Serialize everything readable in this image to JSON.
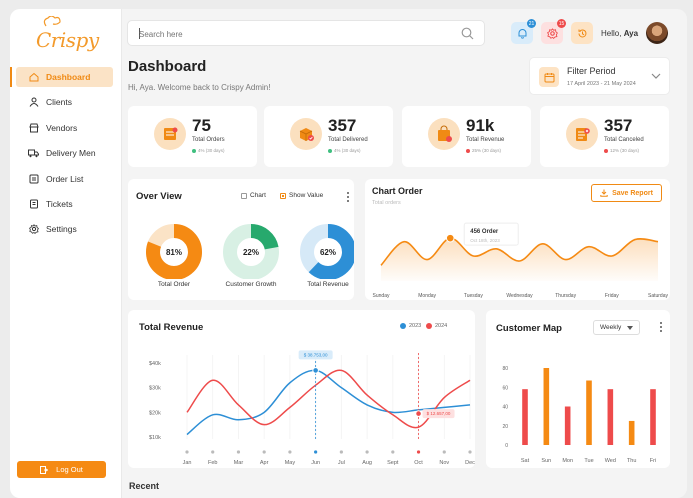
{
  "brand": {
    "logo_text": "Crispy",
    "accent": "#f58a13"
  },
  "sidebar": {
    "items": [
      {
        "label": "Dashboard",
        "icon": "home-icon",
        "active": true
      },
      {
        "label": "Clients",
        "icon": "user-icon",
        "active": false
      },
      {
        "label": "Vendors",
        "icon": "store-icon",
        "active": false
      },
      {
        "label": "Delivery Men",
        "icon": "truck-icon",
        "active": false
      },
      {
        "label": "Order List",
        "icon": "list-icon",
        "active": false
      },
      {
        "label": "Tickets",
        "icon": "ticket-icon",
        "active": false
      },
      {
        "label": "Settings",
        "icon": "gear-icon",
        "active": false
      }
    ],
    "logout_label": "Log Out"
  },
  "header": {
    "search_placeholder": "Search here",
    "notifications_count": "21",
    "settings_count": "15",
    "hello_prefix": "Hello,",
    "user_name": "Aya",
    "title": "Dashboard",
    "subtitle": "Hi, Aya. Welcome back  to Crispy Admin!"
  },
  "filter": {
    "title": "Filter Period",
    "range": "17 April 2023 - 21 May 2024"
  },
  "stats": [
    {
      "value": "75",
      "label": "Total Orders",
      "sub": "4% (30 days)",
      "trend": "up"
    },
    {
      "value": "357",
      "label": "Total Delivered",
      "sub": "4% (30 days)",
      "trend": "up"
    },
    {
      "value": "91k",
      "label": "Total Revenue",
      "sub": "25% (30 days)",
      "trend": "down"
    },
    {
      "value": "357",
      "label": "Total Canceled",
      "sub": "12% (30 days)",
      "trend": "down"
    }
  ],
  "overview": {
    "title": "Over View",
    "chart_label": "Chart",
    "show_value_label": "Show Value",
    "donuts": [
      {
        "label": "Total Order",
        "value": "81%",
        "fraction": 0.81,
        "color": "#f58a13",
        "track": "#fbe3c6"
      },
      {
        "label": "Customer Growth",
        "value": "22%",
        "fraction": 0.22,
        "color": "#27a96d",
        "track": "#d8f0e4"
      },
      {
        "label": "Total Revenue",
        "value": "62%",
        "fraction": 0.62,
        "color": "#2d8fd6",
        "track": "#d6e9f7"
      }
    ]
  },
  "chart_order": {
    "title": "Chart Order",
    "subtitle": "Total orders",
    "save_label": "Save Report",
    "tooltip_value": "456",
    "tooltip_label": "Order",
    "tooltip_date": "Oct 18th, 2023"
  },
  "total_revenue": {
    "title": "Total Revenue",
    "legend": [
      {
        "name": "2023",
        "color": "#2d8fd6"
      },
      {
        "name": "2024",
        "color": "#ee4b4b"
      }
    ],
    "tip1": "$ 38.753,00",
    "tip2": "$ 12.657,00"
  },
  "customer_map": {
    "title": "Customer Map",
    "period": "Weekly"
  },
  "recent_label": "Recent",
  "chart_data": [
    {
      "type": "area",
      "title": "Chart Order",
      "subtitle": "Total orders",
      "categories": [
        "Sunday",
        "Monday",
        "Tuesday",
        "Wednesday",
        "Thursday",
        "Friday",
        "Saturday"
      ],
      "x": [
        0,
        0.5,
        1,
        1.5,
        2,
        2.5,
        3,
        3.5,
        4,
        4.5,
        5,
        5.5,
        6
      ],
      "values": [
        22,
        55,
        30,
        60,
        35,
        45,
        28,
        52,
        30,
        48,
        35,
        58,
        55
      ],
      "highlight": {
        "x": 1.5,
        "label": "456 Order",
        "date": "Oct 18th, 2023"
      }
    },
    {
      "type": "line",
      "title": "Total Revenue",
      "categories": [
        "Jan",
        "Feb",
        "Mar",
        "Apr",
        "May",
        "Jun",
        "Jul",
        "Aug",
        "Sept",
        "Oct",
        "Nov",
        "Dec"
      ],
      "yticks": [
        "$10k",
        "$20k",
        "$30k",
        "$40k"
      ],
      "ylim": [
        10000,
        40000
      ],
      "series": [
        {
          "name": "2023",
          "values": [
            11000,
            19000,
            17000,
            20000,
            32000,
            37000,
            30000,
            23000,
            20000,
            21000,
            22000,
            23000
          ]
        },
        {
          "name": "2024",
          "values": [
            20000,
            33000,
            23000,
            15000,
            22000,
            31000,
            37000,
            27000,
            19000,
            14000,
            26000,
            33000
          ]
        }
      ],
      "annotations": [
        {
          "text": "$ 38.753,00",
          "x": "Jun"
        },
        {
          "text": "$ 12.657,00",
          "x": "Oct"
        }
      ]
    },
    {
      "type": "bar",
      "title": "Customer Map",
      "categories": [
        "Sat",
        "Sun",
        "Mon",
        "Tue",
        "Wed",
        "Thu",
        "Fri"
      ],
      "yticks": [
        "0",
        "20",
        "40",
        "60",
        "80"
      ],
      "ylim": [
        0,
        80
      ],
      "series": [
        {
          "name": "orange",
          "color": "#f58a13",
          "values": [
            null,
            80,
            null,
            67,
            null,
            25,
            null
          ]
        },
        {
          "name": "red",
          "color": "#ee4b4b",
          "values": [
            58,
            null,
            40,
            null,
            58,
            null,
            58
          ]
        }
      ]
    }
  ]
}
